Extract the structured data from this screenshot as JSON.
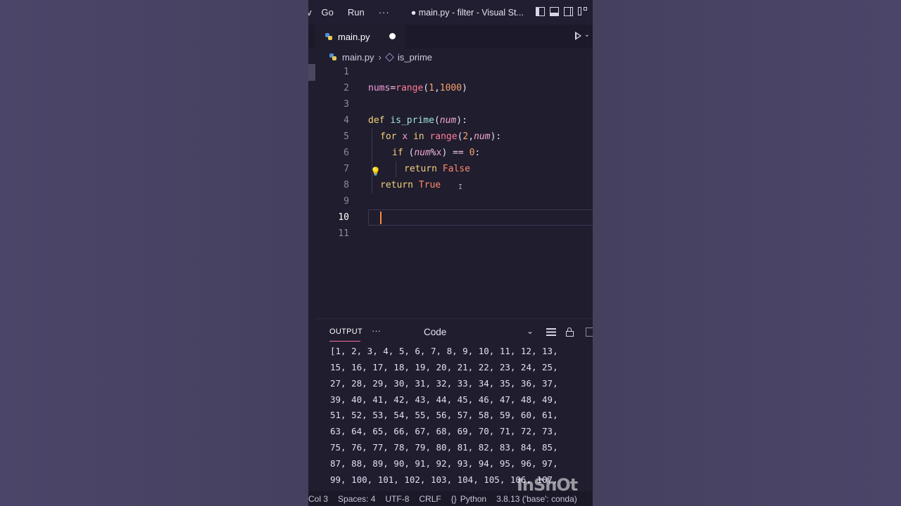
{
  "titlebar": {
    "menu_edge": "v",
    "menu_go": "Go",
    "menu_run": "Run",
    "menu_more": "···",
    "window_title": "● main.py - filter - Visual St..."
  },
  "tab": {
    "filename": "main.py",
    "modified": true
  },
  "breadcrumb": {
    "file": "main.py",
    "symbol": "is_prime"
  },
  "editor": {
    "line_numbers": [
      "1",
      "2",
      "3",
      "4",
      "5",
      "6",
      "7",
      "8",
      "9",
      "10",
      "11"
    ],
    "active_line": "10",
    "lines": {
      "l2": {
        "a": "nums",
        "b": "=",
        "c": "range",
        "d": "(",
        "e": "1",
        "f": ",",
        "g": "1000",
        "h": ")"
      },
      "l4": {
        "a": "def",
        "b": "is_prime",
        "c": "(",
        "d": "num",
        "e": "):"
      },
      "l5": {
        "a": "for",
        "b": "x",
        "c": "in",
        "d": "range",
        "e": "(",
        "f": "2",
        "g": ",",
        "h": "num",
        "i": "):"
      },
      "l6": {
        "a": "if",
        "b": "(",
        "c": "num",
        "d": "%",
        "e": "x",
        "f": ")",
        "g": "==",
        "h": "0",
        "i": ":"
      },
      "l7": {
        "a": "return",
        "b": "False"
      },
      "l8": {
        "a": "return",
        "b": "True"
      }
    }
  },
  "panel": {
    "tab_label": "OUTPUT",
    "more": "···",
    "channel": "Code",
    "output_lines": [
      "[1, 2, 3, 4, 5, 6, 7, 8, 9, 10, 11, 12, 13,",
      "15, 16, 17, 18, 19, 20, 21, 22, 23, 24, 25,",
      "27, 28, 29, 30, 31, 32, 33, 34, 35, 36, 37,",
      "39, 40, 41, 42, 43, 44, 45, 46, 47, 48, 49,",
      "51, 52, 53, 54, 55, 56, 57, 58, 59, 60, 61,",
      "63, 64, 65, 66, 67, 68, 69, 70, 71, 72, 73,",
      "75, 76, 77, 78, 79, 80, 81, 82, 83, 84, 85,",
      "87, 88, 89, 90, 91, 92, 93, 94, 95, 96, 97,",
      "99, 100, 101, 102, 103, 104, 105, 106, 107,"
    ]
  },
  "statusbar": {
    "col": "Col 3",
    "spaces": "Spaces: 4",
    "encoding": "UTF-8",
    "eol": "CRLF",
    "braces": "{}",
    "language": "Python",
    "interpreter": "3.8.13 ('base': conda)"
  },
  "watermark": "InShOt",
  "colors": {
    "background": "#4a4468",
    "editor_bg": "#1f1d2e",
    "cursor": "#ff8a3d",
    "keyword": "#f3d17a",
    "function": "#ff7d9a"
  }
}
